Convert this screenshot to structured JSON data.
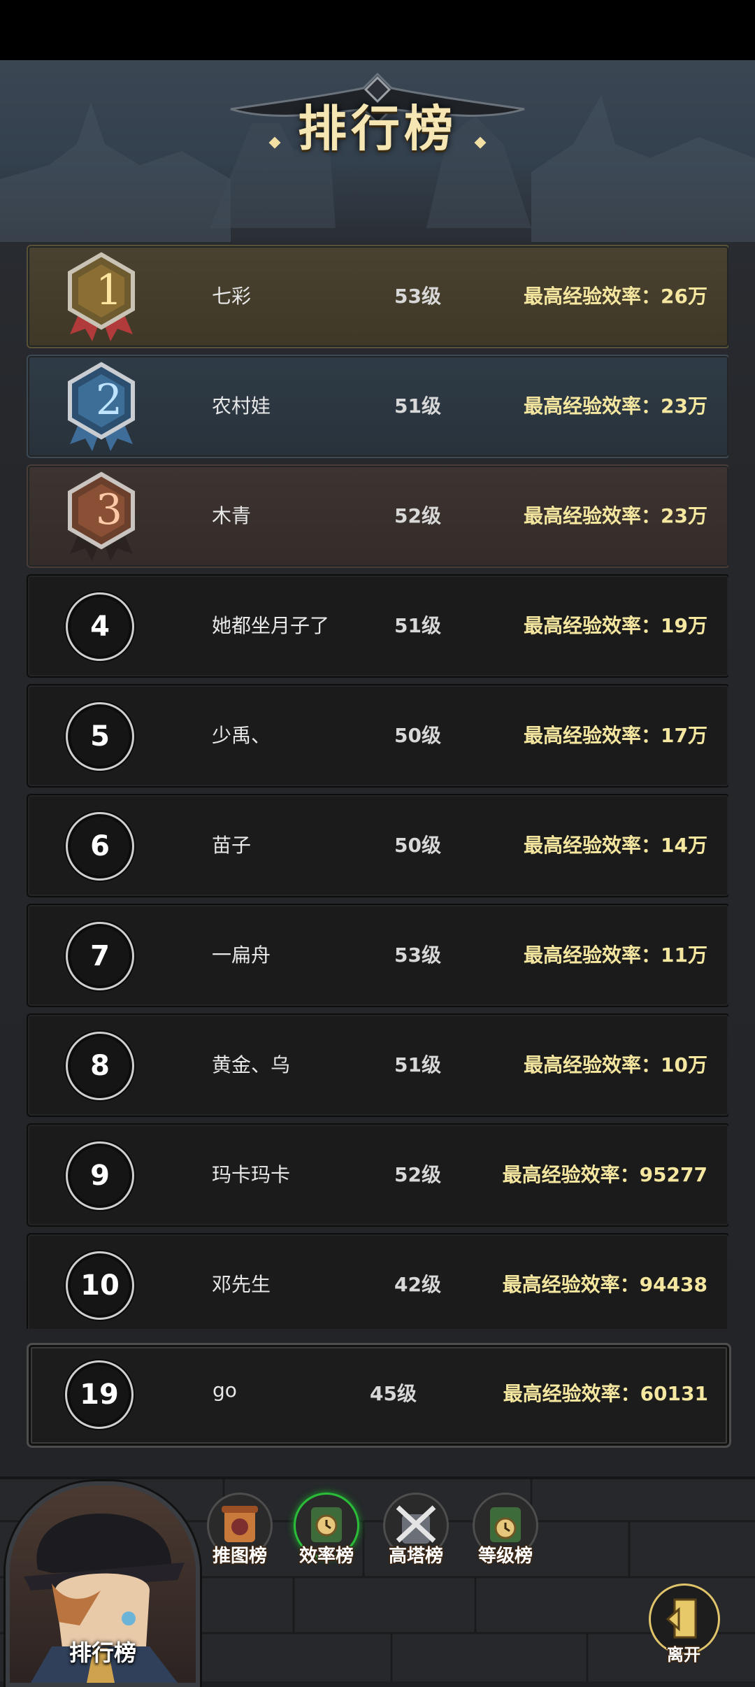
{
  "title": "排行榜",
  "rows": [
    {
      "rank": "1",
      "name": "七彩",
      "level": "53级",
      "stat": "最高经验效率：26万",
      "tier": "gold"
    },
    {
      "rank": "2",
      "name": "农村娃",
      "level": "51级",
      "stat": "最高经验效率：23万",
      "tier": "blue"
    },
    {
      "rank": "3",
      "name": "木青",
      "level": "52级",
      "stat": "最高经验效率：23万",
      "tier": "bronze"
    },
    {
      "rank": "4",
      "name": "她都坐月子了",
      "level": "51级",
      "stat": "最高经验效率：19万",
      "tier": "plain"
    },
    {
      "rank": "5",
      "name": "少禹、",
      "level": "50级",
      "stat": "最高经验效率：17万",
      "tier": "plain"
    },
    {
      "rank": "6",
      "name": "苗子",
      "level": "50级",
      "stat": "最高经验效率：14万",
      "tier": "plain"
    },
    {
      "rank": "7",
      "name": "一扁舟",
      "level": "53级",
      "stat": "最高经验效率：11万",
      "tier": "plain"
    },
    {
      "rank": "8",
      "name": "黄金、乌",
      "level": "51级",
      "stat": "最高经验效率：10万",
      "tier": "plain"
    },
    {
      "rank": "9",
      "name": "玛卡玛卡",
      "level": "52级",
      "stat": "最高经验效率：95277",
      "tier": "plain"
    },
    {
      "rank": "10",
      "name": "邓先生",
      "level": "42级",
      "stat": "最高经验效率：94438",
      "tier": "plain"
    }
  ],
  "self": {
    "rank": "19",
    "name": "go",
    "level": "45级",
    "stat": "最高经验效率：60131"
  },
  "portrait_label": "排行榜",
  "tabs": [
    {
      "label": "推图榜",
      "icon": "map-scroll-icon",
      "active": false
    },
    {
      "label": "效率榜",
      "icon": "clock-scroll-icon",
      "active": true
    },
    {
      "label": "高塔榜",
      "icon": "crossed-swords-icon",
      "active": false
    },
    {
      "label": "等级榜",
      "icon": "level-scroll-icon",
      "active": false
    }
  ],
  "leave_label": "离开",
  "colors": {
    "stat_text": "#f5e7a0",
    "gold_row": "#4a4230",
    "blue_row": "#2f3b46",
    "bronze_row": "#3d3431",
    "active_tab": "#2bbd3a"
  }
}
